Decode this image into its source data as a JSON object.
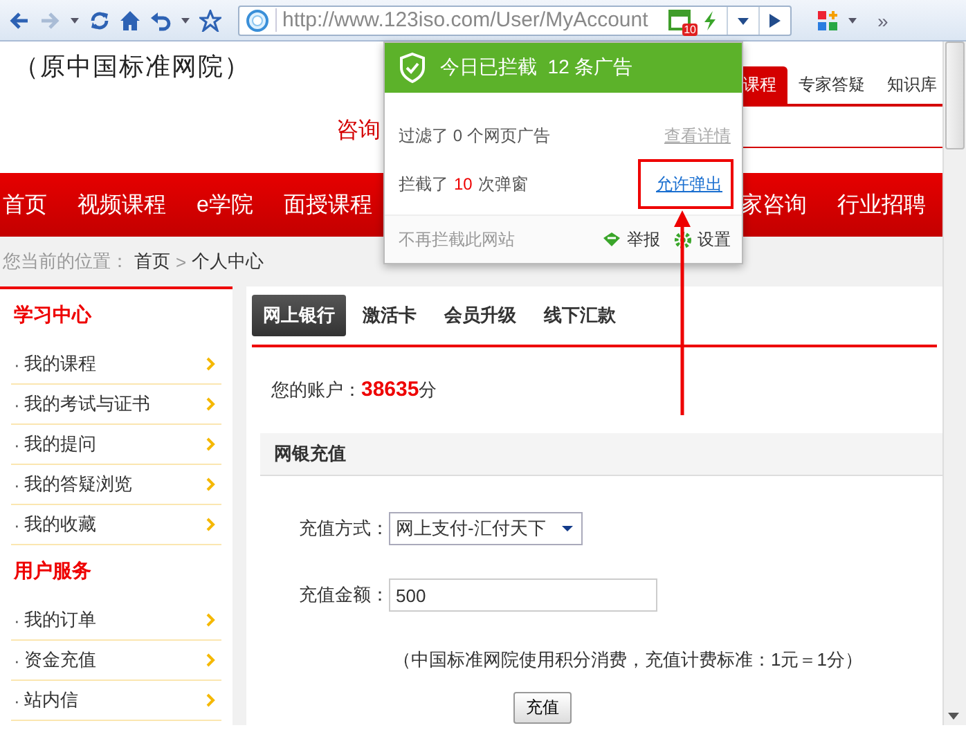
{
  "toolbar": {
    "url": "http://www.123iso.com/User/MyAccount",
    "adblock_badge": "10",
    "overflow": "»"
  },
  "header": {
    "site_subtitle": "（原中国标准网院）",
    "consult": "咨询",
    "tabs": [
      {
        "label": "课程",
        "selected": true
      },
      {
        "label": "专家答疑",
        "selected": false
      },
      {
        "label": "知识库",
        "selected": false
      }
    ]
  },
  "nav": [
    "首页",
    "视频课程",
    "e学院",
    "面授课程",
    "家咨询",
    "行业招聘"
  ],
  "breadcrumb": {
    "prefix": "您当前的位置：",
    "separator": ">",
    "items": [
      "首页",
      "个人中心"
    ]
  },
  "sidebar": {
    "bullet": "·",
    "sections": [
      {
        "title": "学习中心",
        "items": [
          "我的课程",
          "我的考试与证书",
          "我的提问",
          "我的答疑浏览",
          "我的收藏"
        ]
      },
      {
        "title": "用户服务",
        "items": [
          "我的订单",
          "资金充值",
          "站内信"
        ]
      }
    ]
  },
  "account": {
    "tabs": [
      {
        "label": "网上银行",
        "selected": true
      },
      {
        "label": "激活卡",
        "selected": false
      },
      {
        "label": "会员升级",
        "selected": false
      },
      {
        "label": "线下汇款",
        "selected": false
      }
    ],
    "balance_label": "您的账户：",
    "balance": "38635",
    "balance_unit": "分",
    "section_title": "网银充值",
    "method_label": "充值方式：",
    "method_value": "网上支付-汇付天下",
    "amount_label": "充值金额：",
    "amount_value": "500",
    "note": "（中国标准网院使用积分消费，充值计费标准：1元＝1分）",
    "submit": "充值"
  },
  "popup": {
    "title": "今日已拦截  12 条广告",
    "filtered": "过滤了 0 个网页广告",
    "details_link": "查看详情",
    "blocked_prefix": "拦截了",
    "blocked_count": "10",
    "blocked_suffix": "次弹窗",
    "allow_link": "允许弹出",
    "stop_link": "不再拦截此网站",
    "report": "举报",
    "settings": "设置"
  }
}
